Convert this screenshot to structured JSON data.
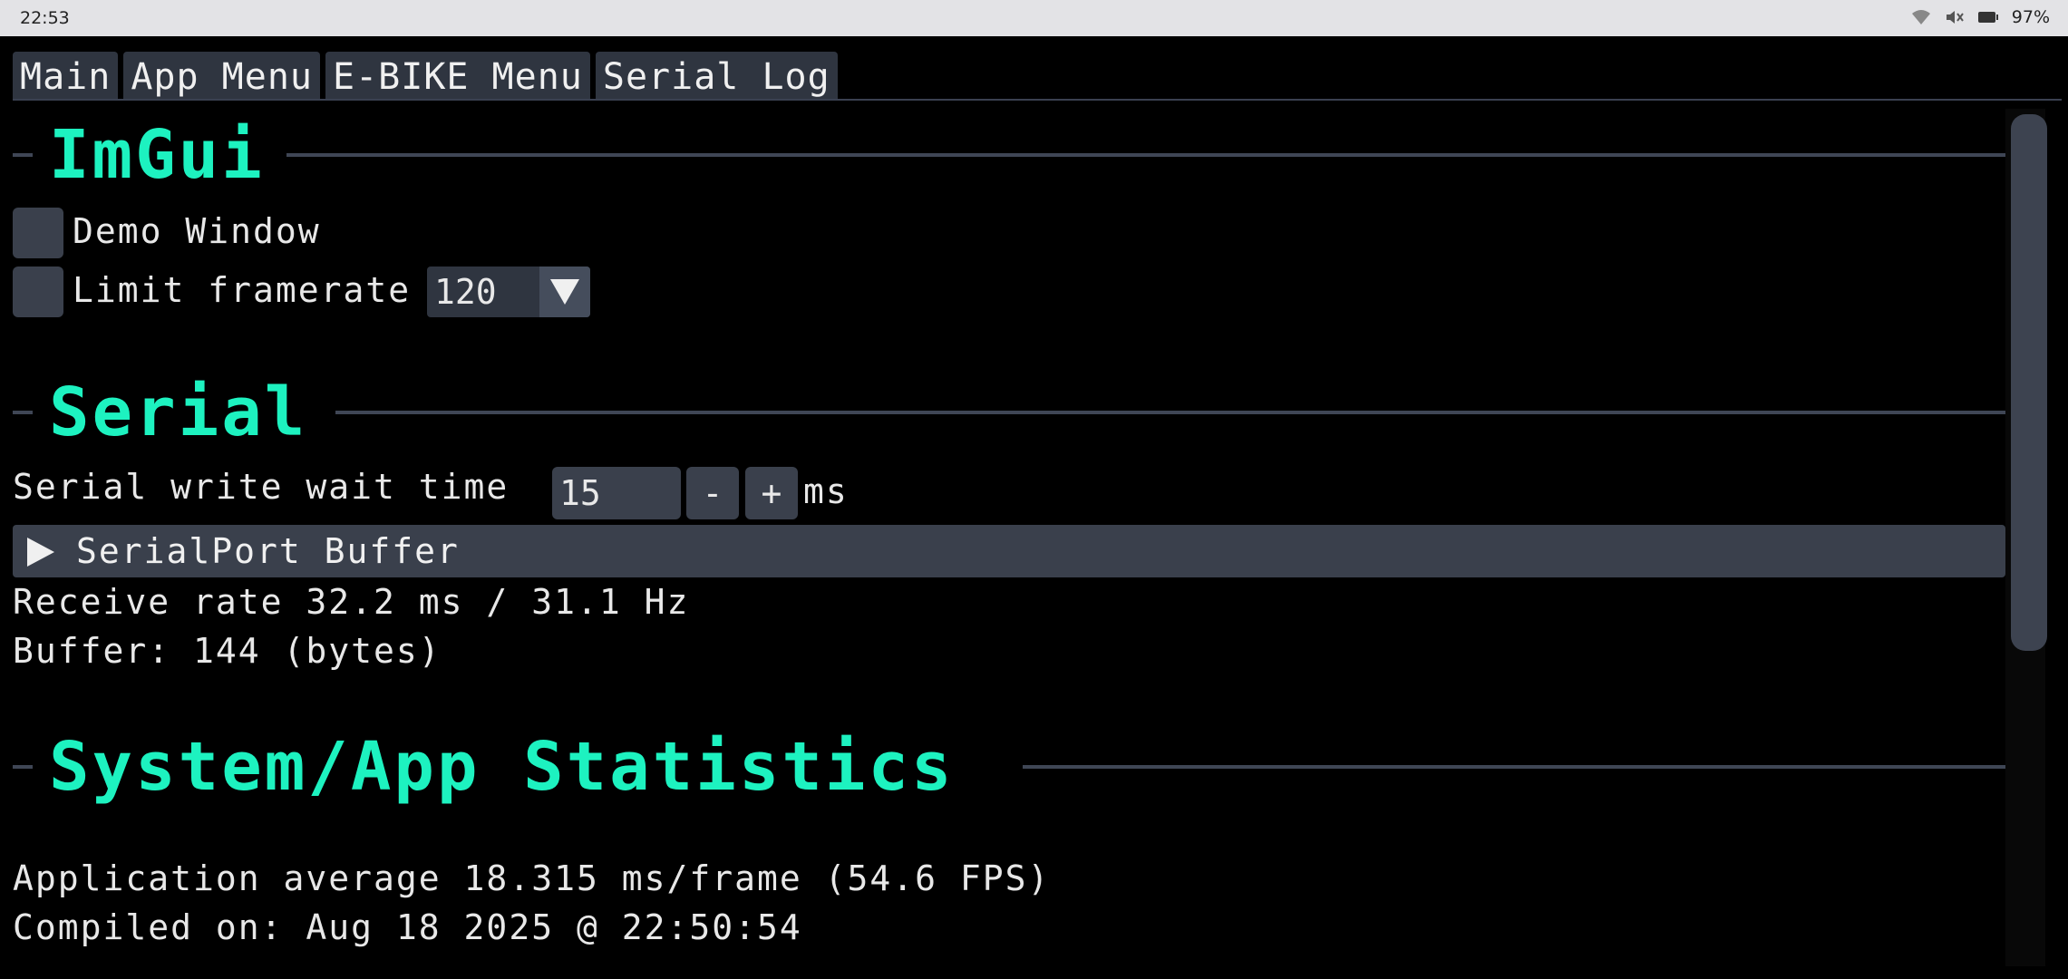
{
  "statusbar": {
    "time": "22:53",
    "battery": "97%",
    "icons": [
      "wifi-icon",
      "muted-icon",
      "battery-icon"
    ]
  },
  "tabs": [
    {
      "label": "Main"
    },
    {
      "label": "App Menu"
    },
    {
      "label": "E-BIKE Menu"
    },
    {
      "label": "Serial Log"
    }
  ],
  "imgui": {
    "title": "ImGui",
    "demo_window_label": "Demo Window",
    "limit_framerate_label": "Limit framerate",
    "framerate_value": "120"
  },
  "serial": {
    "title": "Serial",
    "wait_label": "Serial write wait time",
    "wait_value": "15",
    "minus_label": "-",
    "plus_label": "+",
    "unit": "ms",
    "buffer_tree_label": "SerialPort Buffer",
    "receive_rate": "Receive rate 32.2 ms / 31.1 Hz",
    "buffer": "Buffer: 144 (bytes)"
  },
  "stats": {
    "title": "System/App Statistics",
    "app_average": "Application average 18.315 ms/frame (54.6 FPS)",
    "compiled_on": "Compiled on: Aug 18 2025 @ 22:50:54"
  },
  "colors": {
    "accent": "#1df2c0",
    "frame_bg": "#3a404c",
    "tab_bg": "#2f3540"
  }
}
